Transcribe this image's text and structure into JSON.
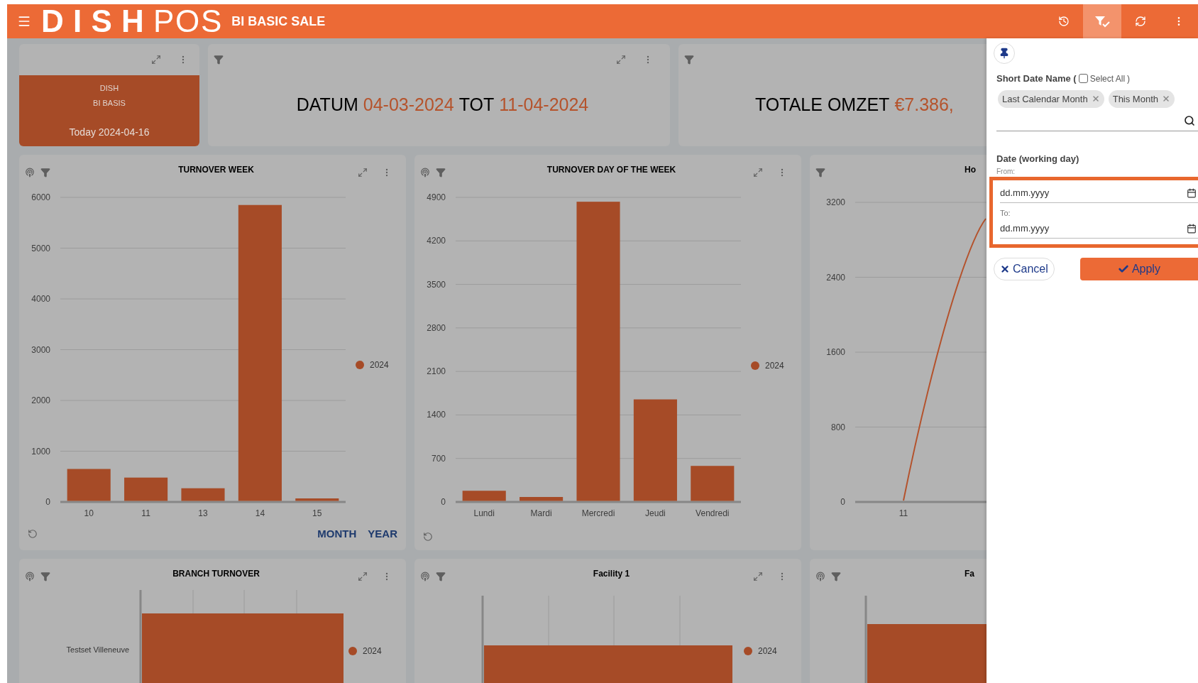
{
  "header": {
    "logo_bold": "DISH",
    "logo_light": "POS",
    "title": "BI BASIC SALE",
    "tools": [
      {
        "kind": "history",
        "selected": false
      },
      {
        "kind": "filter_check",
        "selected": true
      },
      {
        "kind": "refresh",
        "selected": false
      },
      {
        "kind": "more",
        "selected": false
      }
    ]
  },
  "summary_cards": [
    {
      "kind": "info",
      "lines": [
        "DISH",
        "BI BASIS"
      ],
      "footer": "Today 2024-04-16"
    },
    {
      "kind": "headline",
      "clipped": false,
      "parts": [
        {
          "text": "DATUM",
          "accent": false
        },
        {
          "text": "04-03-2024",
          "accent": true
        },
        {
          "text": "TOT",
          "accent": false
        },
        {
          "text": "11-04-2024",
          "accent": true
        }
      ]
    },
    {
      "kind": "headline",
      "clipped": true,
      "parts": [
        {
          "text": "TOTALE OMZET",
          "accent": false
        },
        {
          "text": "€7.386,",
          "accent": true
        }
      ]
    }
  ],
  "chart_cards": [
    {
      "kind": "bar",
      "title": "TURNOVER WEEK",
      "clipped": false,
      "pinnable": true,
      "resettable": true,
      "footer_links": [
        "MONTH",
        "YEAR"
      ],
      "chart_data": {
        "type": "bar",
        "categories": [
          "10",
          "11",
          "13",
          "14",
          "15"
        ],
        "series": [
          {
            "name": "2024",
            "color": "#a64b27",
            "values": [
              650,
              480,
              270,
              5850,
              70
            ]
          }
        ],
        "grid": true,
        "ylim": [
          0,
          6000
        ],
        "yticks": [
          0,
          1000,
          2000,
          3000,
          4000,
          5000,
          6000
        ]
      }
    },
    {
      "kind": "bar",
      "title": "TURNOVER DAY OF THE WEEK",
      "clipped": false,
      "pinnable": true,
      "resettable": true,
      "chart_data": {
        "type": "bar",
        "categories": [
          "Lundi",
          "Mardi",
          "Mercredi",
          "Jeudi",
          "Vendredi"
        ],
        "series": [
          {
            "name": "2024",
            "color": "#a64b27",
            "values": [
              180,
              80,
              4830,
              1650,
              580
            ]
          }
        ],
        "grid": true,
        "ylim": [
          0,
          4900
        ],
        "yticks": [
          0,
          700,
          1400,
          2100,
          2800,
          3500,
          4200,
          4900
        ]
      }
    },
    {
      "kind": "line",
      "title": "Ho",
      "clipped": true,
      "pinnable": false,
      "resettable": false,
      "color": "#b4522c",
      "y_labels": [
        "3200",
        "2400",
        "1600",
        "800",
        "0"
      ],
      "x_labels": [
        "11"
      ]
    },
    {
      "kind": "branch",
      "title": "BRANCH TURNOVER",
      "clipped": false,
      "pinnable": true,
      "legend": "2024",
      "color": "#a64b27",
      "category_labels": [
        "Testset Villeneuve"
      ]
    },
    {
      "kind": "facility",
      "title": "Facility 1",
      "clipped": false,
      "pinnable": true,
      "legend": "2024",
      "color": "#a64b27"
    },
    {
      "kind": "facility_cut",
      "title": "Fa",
      "clipped": true,
      "pinnable": true,
      "color": "#a64b27"
    }
  ],
  "filter_panel": {
    "field_label": "Short Date Name (",
    "select_all": {
      "label": "Select All",
      "checked": false
    },
    "close_paren": ")",
    "chips": [
      "Last Calendar Month",
      "This Month"
    ],
    "date_label": "Date (working day)",
    "from_label": "From:",
    "from_placeholder": "dd.mm.yyyy",
    "to_label": "To:",
    "to_placeholder": "dd.mm.yyyy",
    "cancel": "Cancel",
    "apply": "Apply"
  }
}
